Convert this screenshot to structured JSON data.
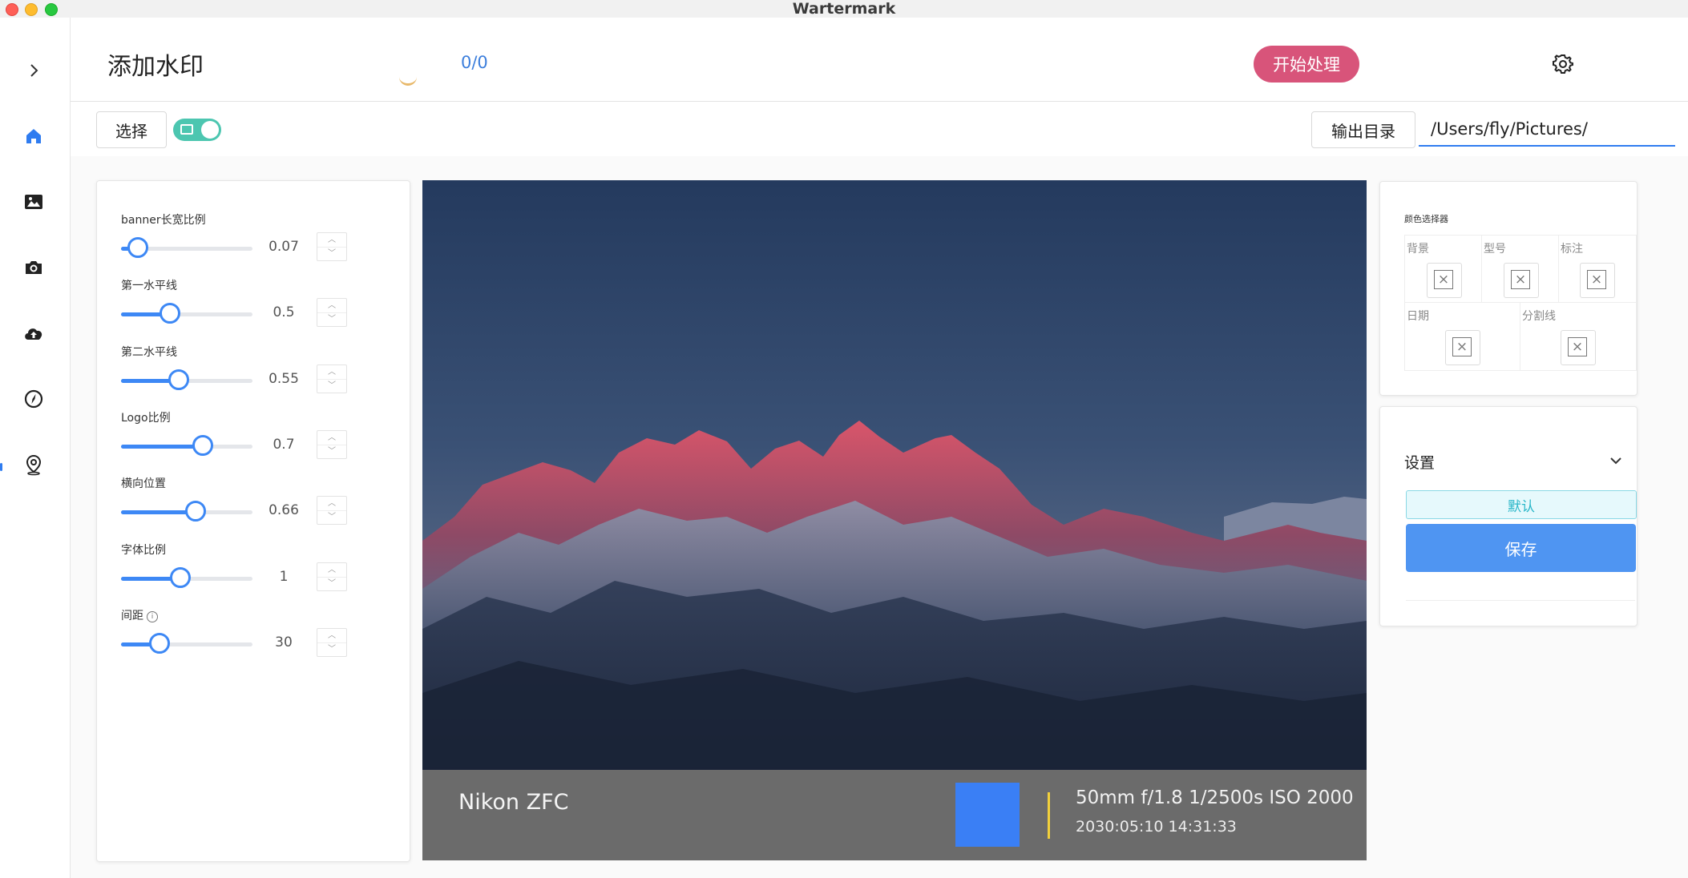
{
  "window": {
    "title": "Wartermark"
  },
  "rail": {
    "items": [
      {
        "name": "expand-icon",
        "icon": "chevron-right"
      },
      {
        "name": "home-icon",
        "icon": "home"
      },
      {
        "name": "image-icon",
        "icon": "image"
      },
      {
        "name": "camera-icon",
        "icon": "camera"
      },
      {
        "name": "cloud-upload-icon",
        "icon": "cloud-upload"
      },
      {
        "name": "compass-icon",
        "icon": "compass"
      },
      {
        "name": "location-icon",
        "icon": "location-pin"
      }
    ],
    "active": "home-icon",
    "accent": "#2f7cf0"
  },
  "header": {
    "title": "添加水印",
    "counter": "0/0",
    "start_label": "开始处理",
    "start_color": "#d8547a",
    "settings_icon": "gear-icon"
  },
  "toolbar": {
    "select_label": "选择",
    "toggle_on": true,
    "output_label": "输出目录",
    "output_path": "/Users/fly/Pictures/",
    "path_status": "valid"
  },
  "sliders": [
    {
      "label": "banner长宽比例",
      "value": "0.07",
      "fraction": 0.13,
      "info": false
    },
    {
      "label": "第一水平线",
      "value": "0.5",
      "fraction": 0.37,
      "info": false
    },
    {
      "label": "第二水平线",
      "value": "0.55",
      "fraction": 0.44,
      "info": false
    },
    {
      "label": "Logo比例",
      "value": "0.7",
      "fraction": 0.62,
      "info": false
    },
    {
      "label": "横向位置",
      "value": "0.66",
      "fraction": 0.57,
      "info": false
    },
    {
      "label": "字体比例",
      "value": "1",
      "fraction": 0.45,
      "info": false
    },
    {
      "label": "间距",
      "value": "30",
      "fraction": 0.29,
      "info": true
    }
  ],
  "preview": {
    "brand": "Nikon ZFC",
    "params": "50mm f/1.8 1/2500s ISO 2000",
    "date": "2030:05:10 14:31:33",
    "banner_color": "#6b6b6b",
    "logo_color": "#3a7ff5",
    "divider_color": "#f2d03b"
  },
  "color_picker": {
    "title": "颜色选择器",
    "cells": [
      {
        "label": "背景"
      },
      {
        "label": "型号"
      },
      {
        "label": "标注"
      },
      {
        "label": "日期"
      },
      {
        "label": "分割线"
      }
    ]
  },
  "settings": {
    "title": "设置",
    "default_label": "默认",
    "save_label": "保存"
  }
}
